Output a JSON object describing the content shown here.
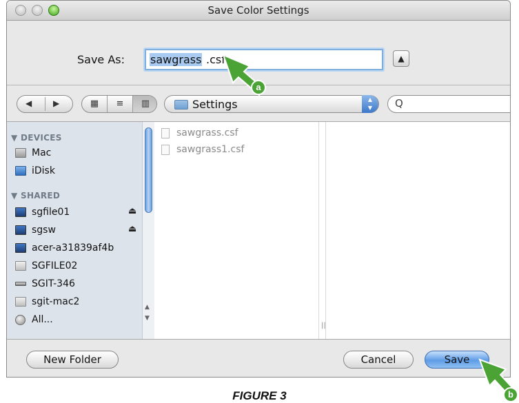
{
  "window": {
    "title": "Save Color Settings"
  },
  "save_as": {
    "label": "Save As:",
    "filename_selected": "sawgrass",
    "filename_ext": ".csf"
  },
  "toolbar": {
    "back_icon": "◀",
    "forward_icon": "▶",
    "view_icon_grid": "▦",
    "view_icon_list": "≡",
    "view_icon_columns": "▥",
    "location": "Settings",
    "search_glyph": "Q"
  },
  "sidebar": {
    "devices_header": "▼ DEVICES",
    "devices": [
      {
        "label": "Mac",
        "icon": "hard-disk-icon"
      },
      {
        "label": "iDisk",
        "icon": "idisk-icon"
      }
    ],
    "shared_header": "▼ SHARED",
    "shared": [
      {
        "label": "sgfile01",
        "icon": "monitor-icon",
        "eject": true
      },
      {
        "label": "sgsw",
        "icon": "monitor-icon",
        "eject": true
      },
      {
        "label": "acer-a31839af4b",
        "icon": "monitor-icon",
        "eject": false
      },
      {
        "label": "SGFILE02",
        "icon": "generic-server-icon",
        "eject": false
      },
      {
        "label": "SGIT-346",
        "icon": "network-drive-icon",
        "eject": false
      },
      {
        "label": "sgit-mac2",
        "icon": "generic-server-icon",
        "eject": false
      },
      {
        "label": "All...",
        "icon": "network-globe-icon",
        "eject": false
      }
    ]
  },
  "files": [
    {
      "name": "sawgrass.csf"
    },
    {
      "name": "sawgrass1.csf"
    }
  ],
  "buttons": {
    "new_folder": "New Folder",
    "cancel": "Cancel",
    "save": "Save"
  },
  "annotations": {
    "a": "a",
    "b": "b",
    "arrow_color": "#4aa334"
  },
  "caption": "FIGURE 3"
}
